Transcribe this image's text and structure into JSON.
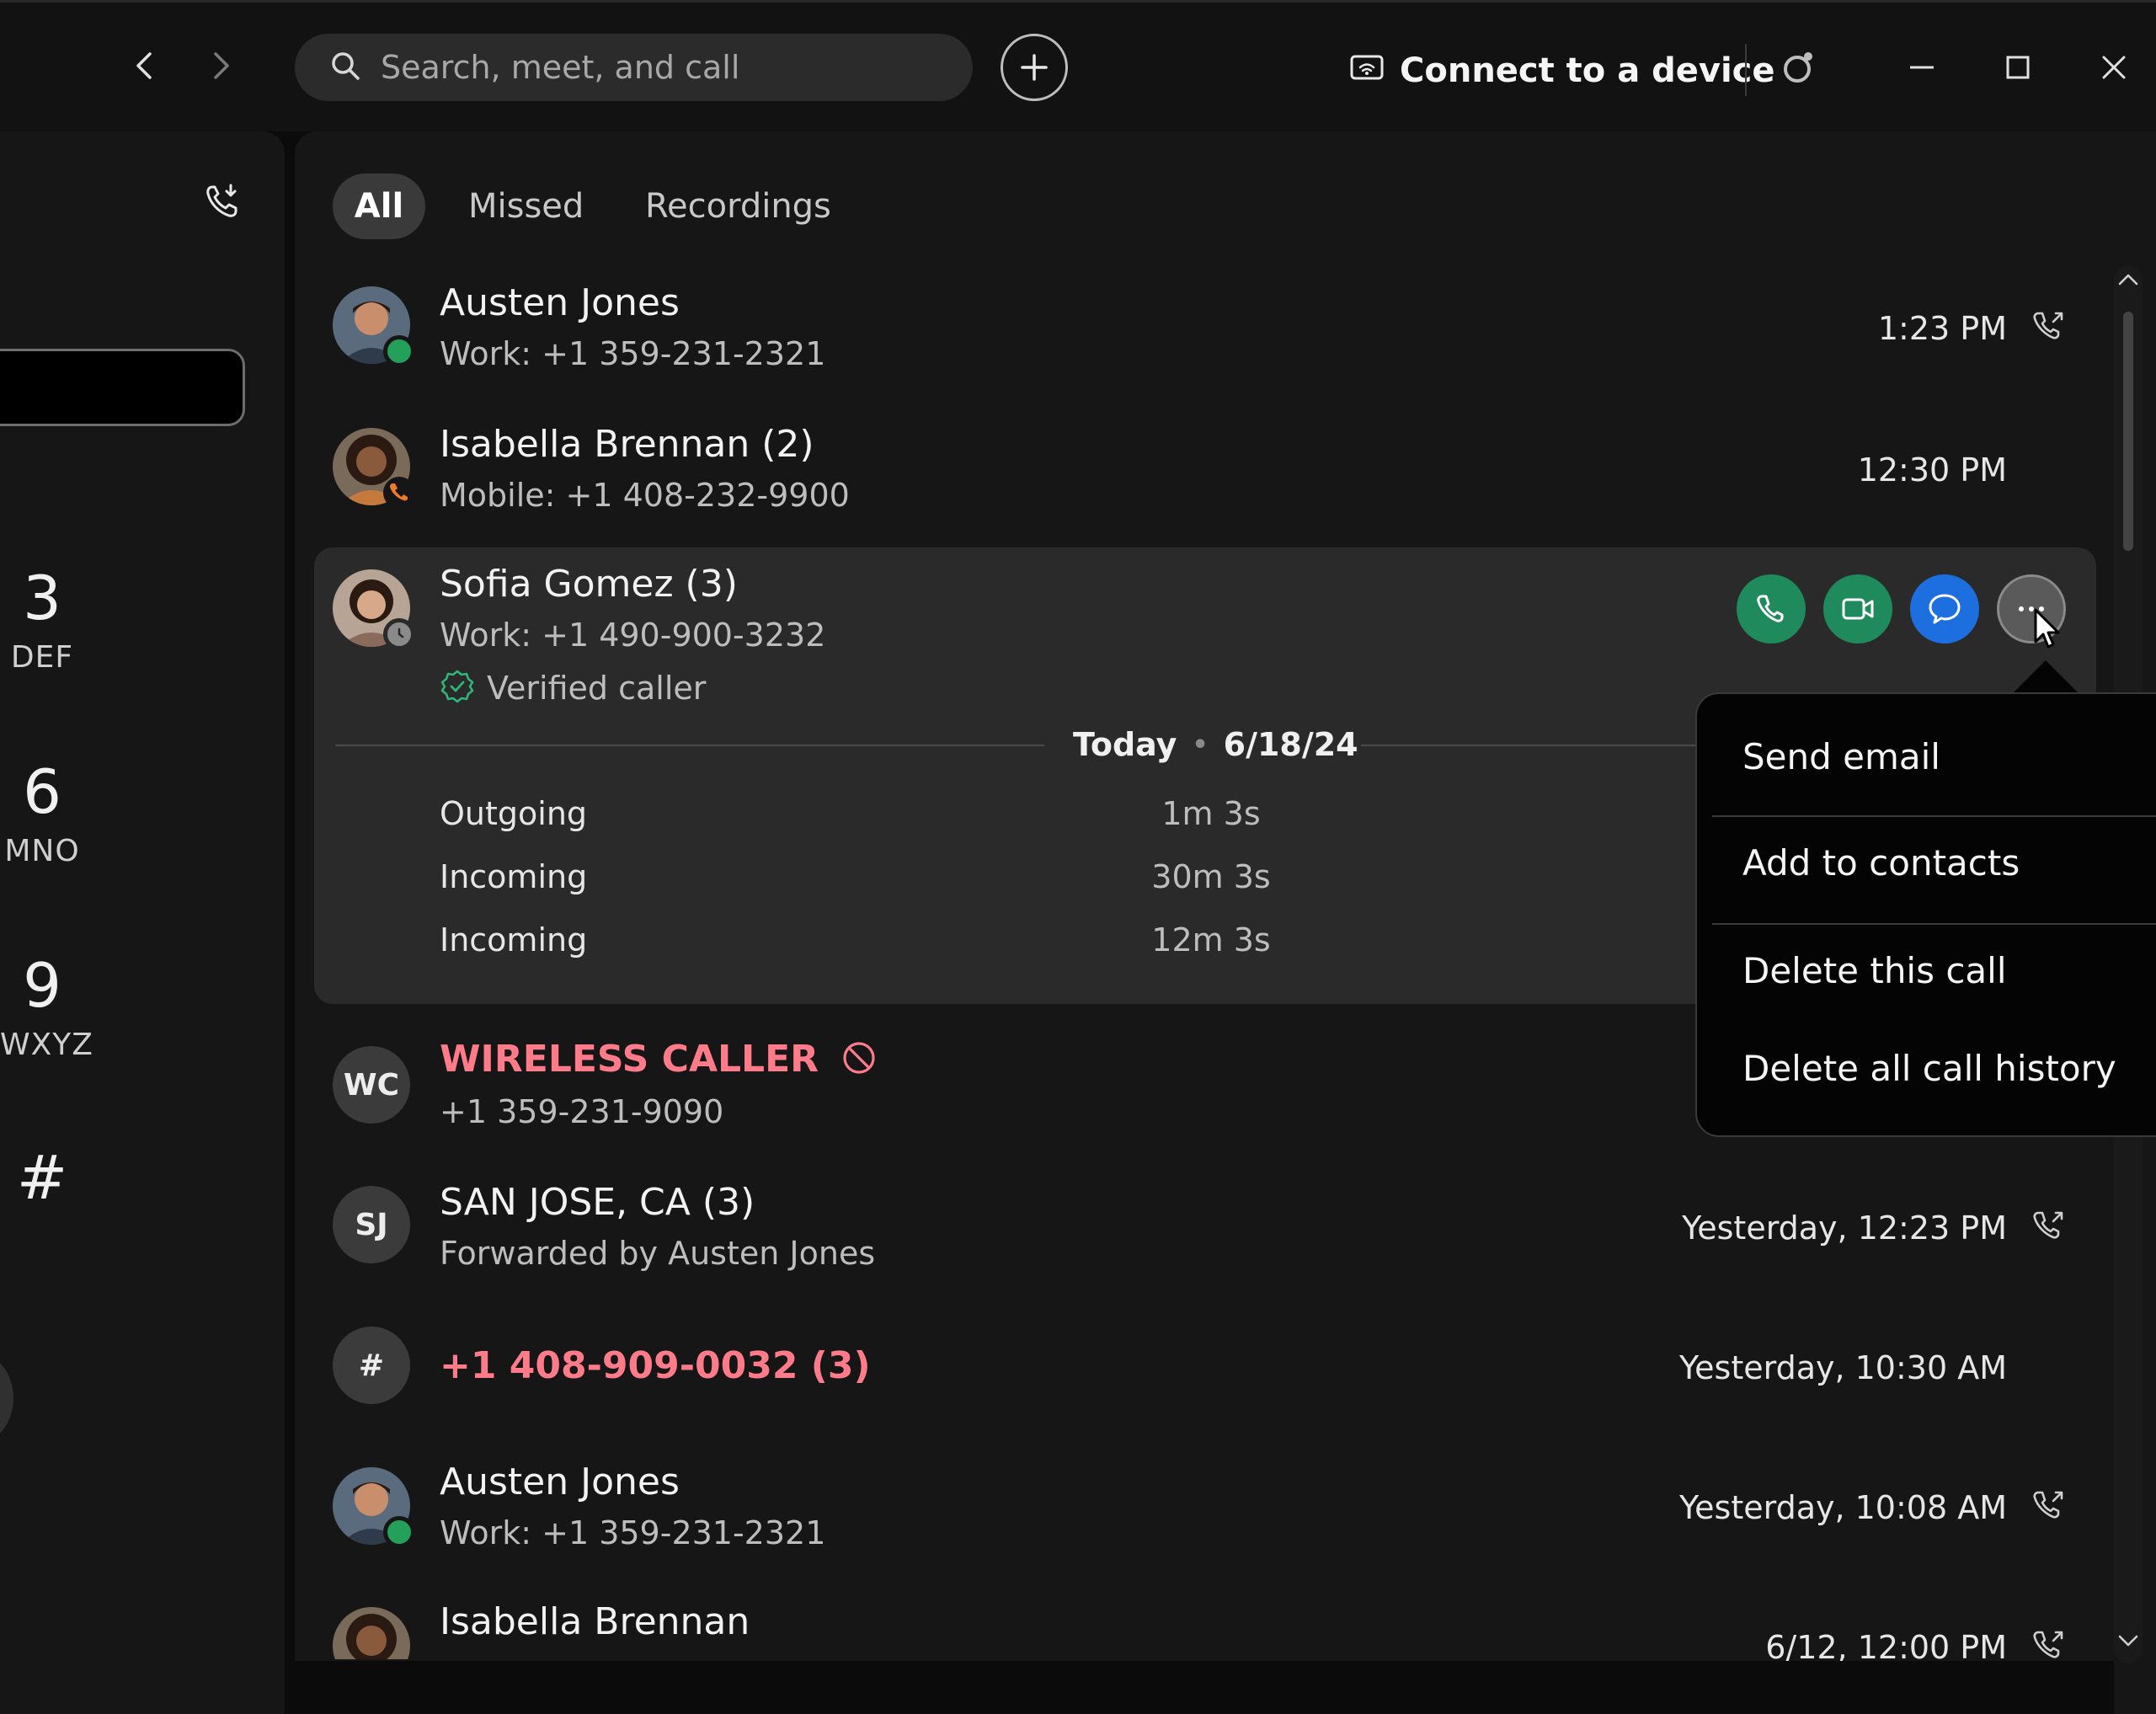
{
  "search": {
    "placeholder": "Search, meet, and call"
  },
  "titlebar": {
    "connect_label": "Connect to a device"
  },
  "dialpad": {
    "keys": [
      {
        "num": "3",
        "letters": "DEF"
      },
      {
        "num": "6",
        "letters": "MNO"
      },
      {
        "num": "9",
        "letters": "WXYZ"
      },
      {
        "num": "#",
        "letters": ""
      }
    ]
  },
  "tabs": {
    "all": "All",
    "missed": "Missed",
    "recordings": "Recordings"
  },
  "calls": [
    {
      "name": "Austen Jones",
      "sub": "Work: +1 359-231-2321",
      "time": "1:23 PM",
      "icon": "outgoing-call-icon"
    },
    {
      "name": "Isabella Brennan (2)",
      "sub": "Mobile: +1 408-232-9900",
      "time": "12:30 PM",
      "icon": ""
    },
    {
      "name": "Sofia Gomez (3)",
      "sub": "Work: +1 490-900-3232",
      "verified": "Verified caller"
    },
    {
      "initials": "WC",
      "name": "WIRELESS CALLER",
      "sub": "+1 359-231-9090"
    },
    {
      "initials": "SJ",
      "name": "SAN JOSE, CA (3)",
      "sub": "Forwarded by Austen Jones",
      "time": "Yesterday, 12:23 PM",
      "icon": "outgoing-call-icon"
    },
    {
      "initials": "#",
      "name": "+1 408-909-0032 (3)",
      "time": "Yesterday, 10:30 AM"
    },
    {
      "name": "Austen Jones",
      "sub": "Work: +1 359-231-2321",
      "time": "Yesterday, 10:08 AM",
      "icon": "outgoing-call-icon"
    },
    {
      "name": "Isabella Brennan",
      "time": "6/12, 12:00 PM",
      "icon": "outgoing-call-icon"
    }
  ],
  "selected_detail": {
    "day": "Today",
    "date": "6/18/24",
    "entries": [
      {
        "type": "Outgoing",
        "duration": "1m 3s"
      },
      {
        "type": "Incoming",
        "duration": "30m 3s"
      },
      {
        "type": "Incoming",
        "duration": "12m 3s"
      }
    ]
  },
  "menu": {
    "send_email": "Send email",
    "add_to_contacts": "Add to contacts",
    "delete_call": "Delete this call",
    "delete_all": "Delete all call history"
  },
  "colors": {
    "background": "#0b0b0b",
    "panel": "#161616",
    "selected_row": "#2a2a2a",
    "call_green": "#1f8a5c",
    "chat_blue": "#1d6fe0",
    "missed_red": "#ff7b8a",
    "presence_green": "#23a05a",
    "presence_orange": "#f07a2a"
  }
}
